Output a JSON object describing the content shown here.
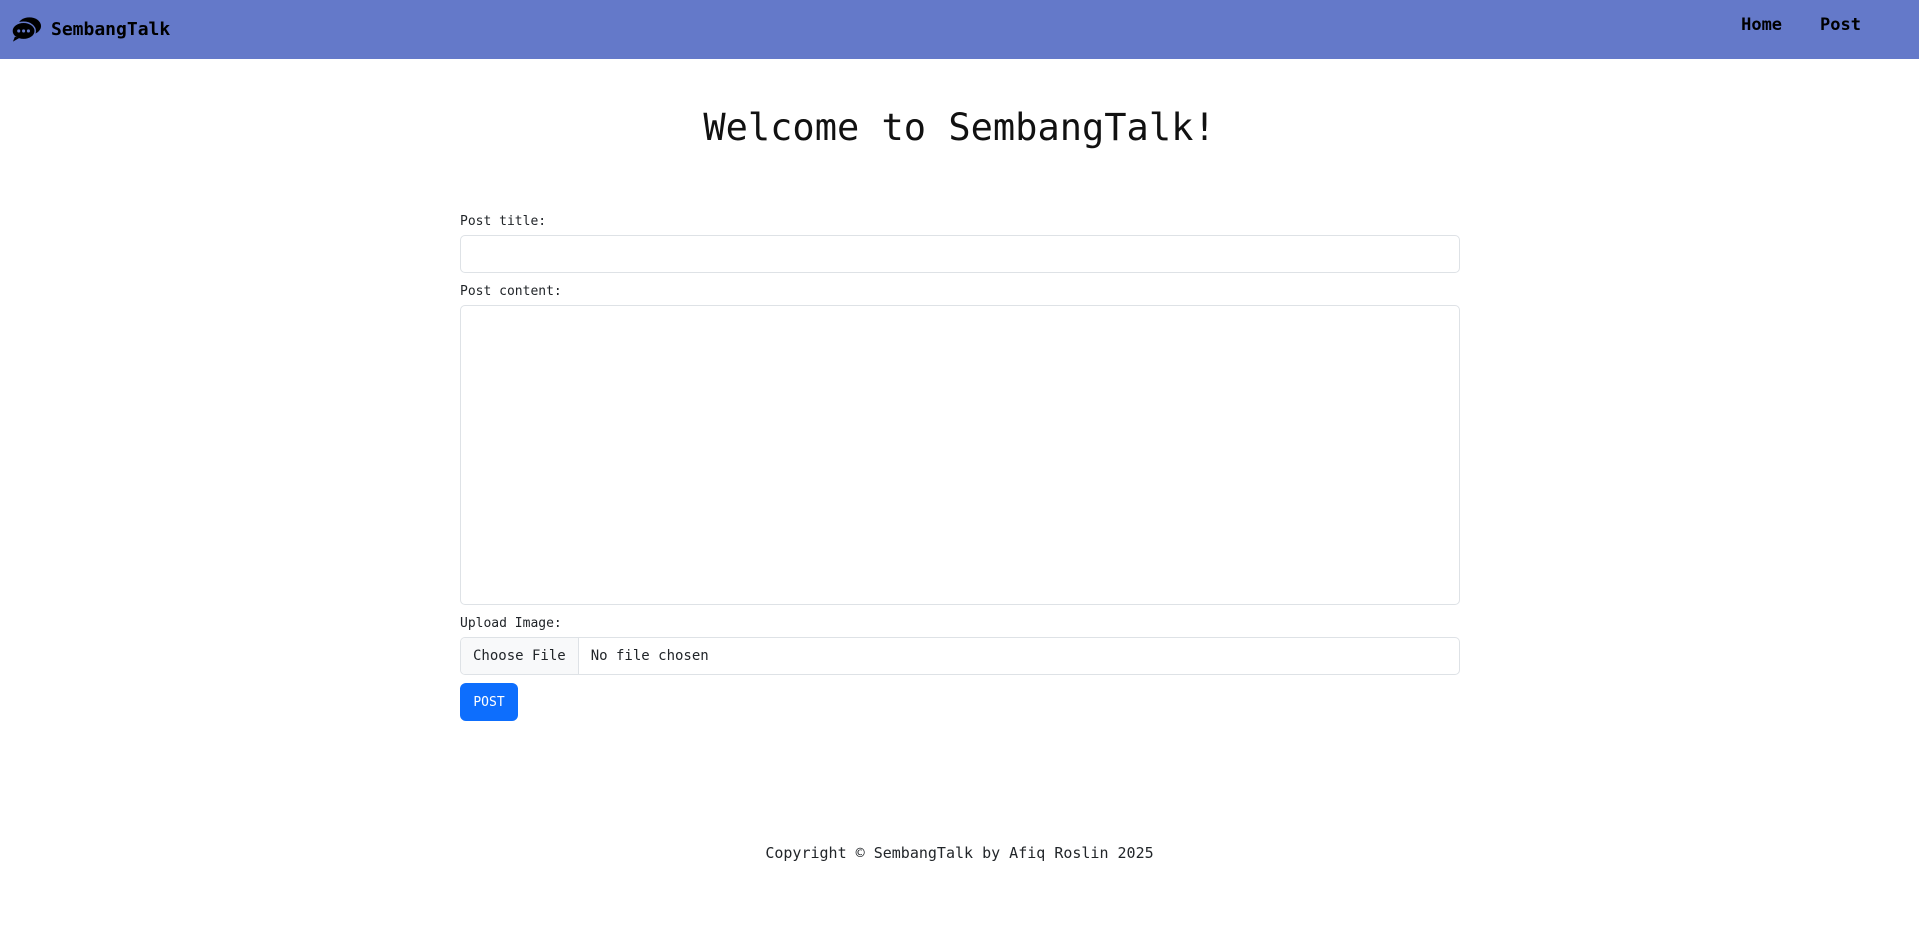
{
  "navbar": {
    "brand_name": "SembangTalk",
    "brand_icon": "chat-bubbles-icon",
    "links": [
      {
        "label": "Home"
      },
      {
        "label": "Post"
      }
    ],
    "background_color": "#6479c9"
  },
  "main": {
    "heading": "Welcome to SembangTalk!"
  },
  "form": {
    "title_label": "Post title:",
    "title_value": "",
    "content_label": "Post content:",
    "content_value": "",
    "upload_label": "Upload Image:",
    "choose_file_label": "Choose File",
    "file_status": "No file chosen",
    "submit_label": "POST",
    "submit_color": "#0d6efd"
  },
  "footer": {
    "text": "Copyright © SembangTalk by Afiq Roslin 2025"
  }
}
